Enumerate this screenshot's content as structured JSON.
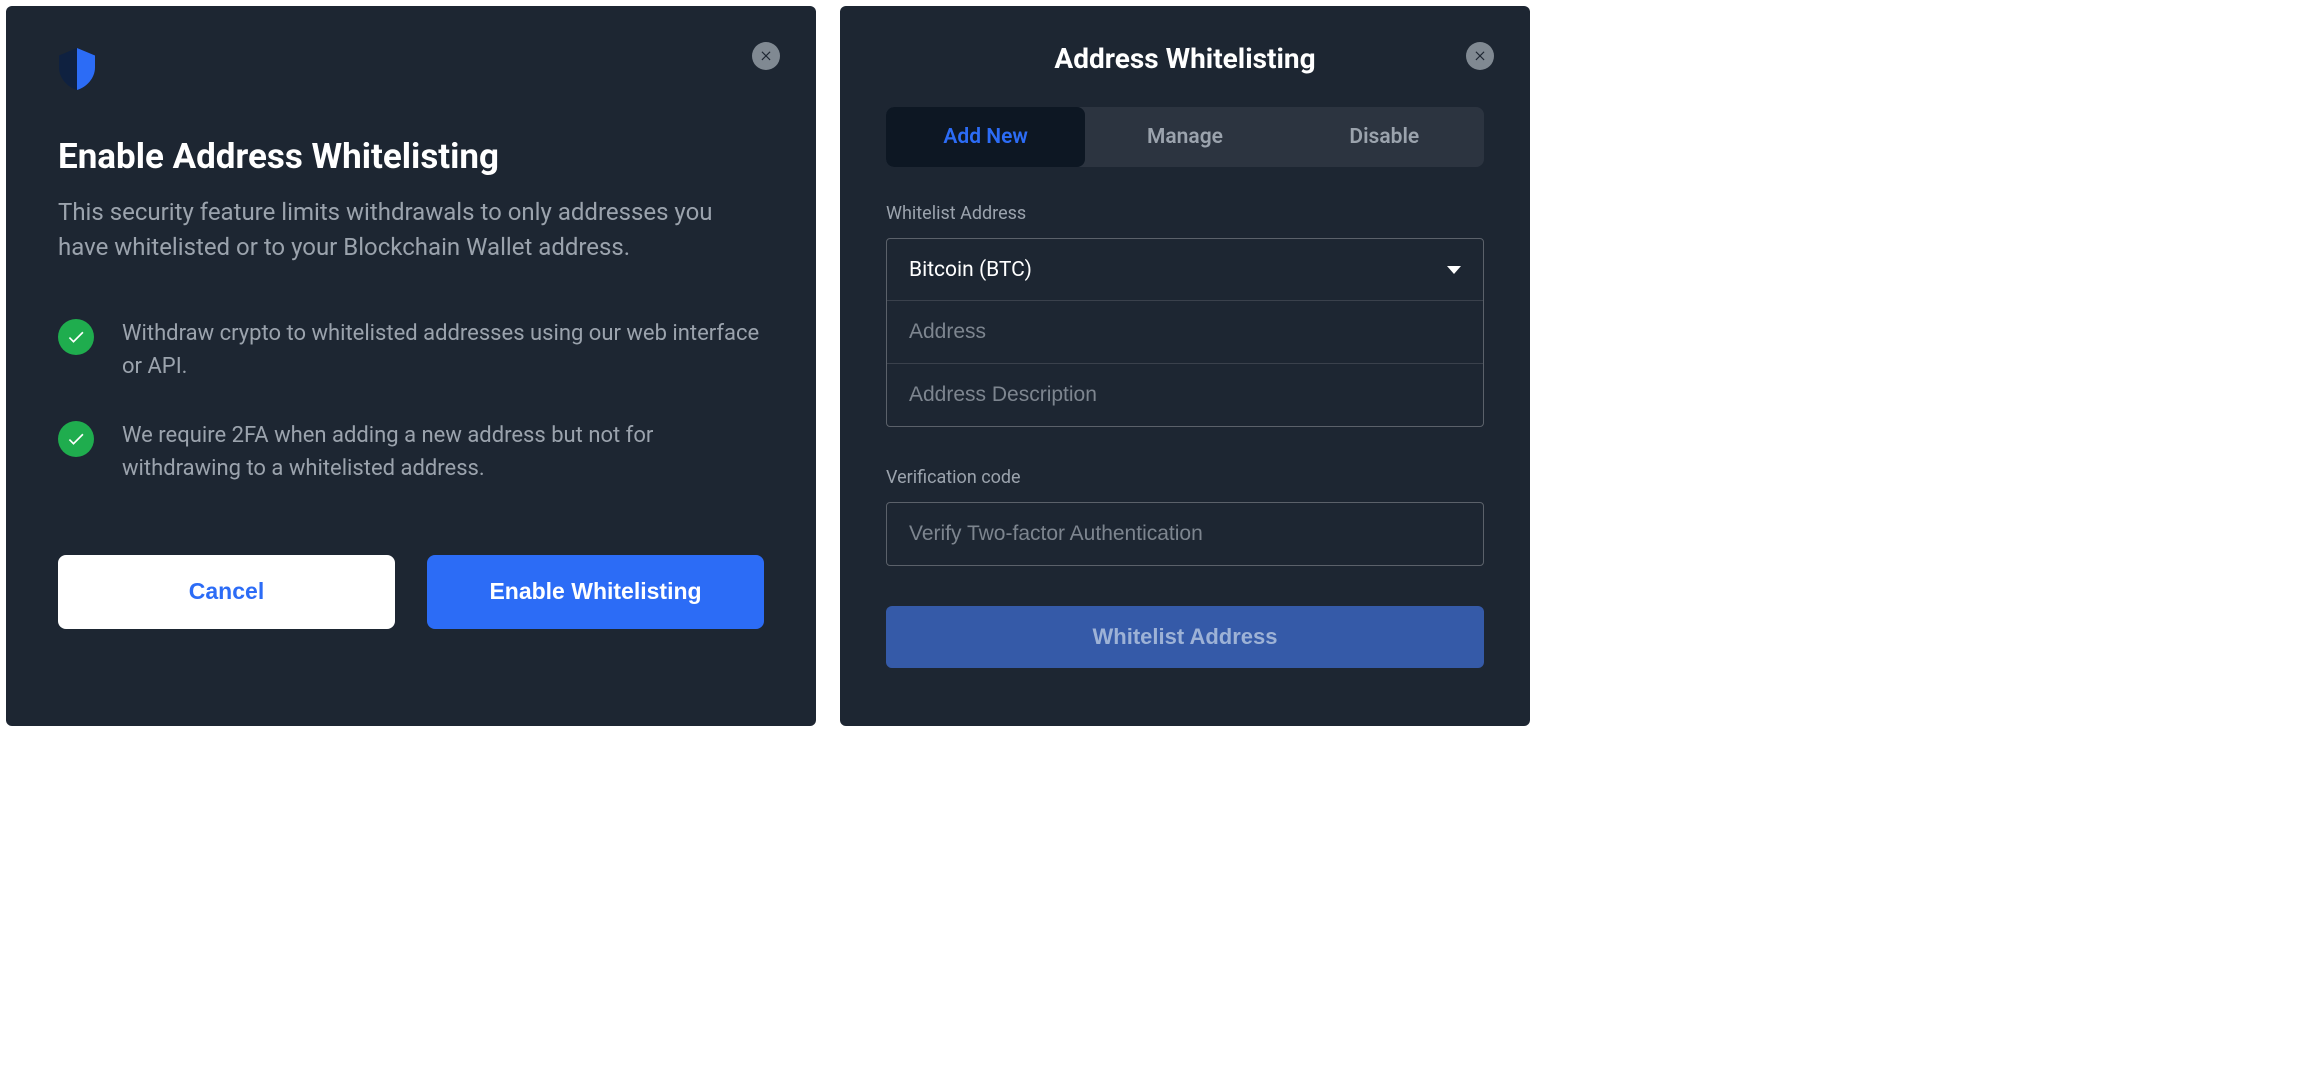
{
  "left": {
    "title": "Enable Address Whitelisting",
    "subtitle": "This security feature limits withdrawals to only addresses you have whitelisted or to your Blockchain Wallet address.",
    "bullets": [
      "Withdraw crypto to whitelisted addresses using our web interface or API.",
      "We require 2FA when adding a new address but not for withdrawing to a whitelisted address."
    ],
    "cancel_label": "Cancel",
    "enable_label": "Enable Whitelisting"
  },
  "right": {
    "title": "Address Whitelisting",
    "tabs": {
      "add_new": "Add New",
      "manage": "Manage",
      "disable": "Disable",
      "active": "add_new"
    },
    "section_label": "Whitelist Address",
    "coin_selected": "Bitcoin (BTC)",
    "address_placeholder": "Address",
    "description_placeholder": "Address Description",
    "verify_label": "Verification code",
    "verify_placeholder": "Verify Two-factor Authentication",
    "submit_label": "Whitelist Address"
  },
  "icons": {
    "close": "close-icon",
    "shield": "shield-icon",
    "check": "check-icon",
    "caret": "chevron-down-icon"
  },
  "colors": {
    "accent": "#2c6cf6",
    "success": "#1fad4e",
    "panel_bg": "#1d2632"
  }
}
